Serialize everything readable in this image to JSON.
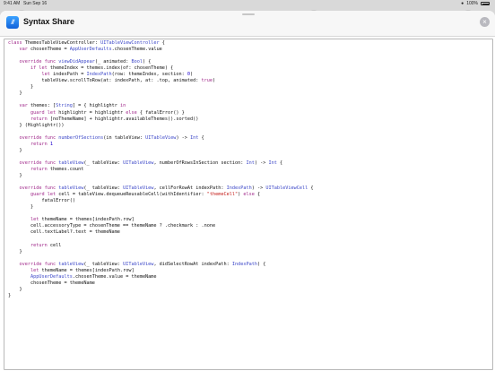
{
  "status_bar": {
    "time": "9:41 AM",
    "date": "Sun Sep 16",
    "battery": "100%"
  },
  "header": {
    "title": "Syntax Share",
    "app_icon_text": "//",
    "close_icon": "close-icon"
  },
  "colors": {
    "keyword": "#a0288a",
    "type": "#3c47c8",
    "string": "#c41a16",
    "number": "#1c00cf",
    "plain": "#111111",
    "accent": "#1a7cf0"
  },
  "code_lines": [
    [
      [
        "kw",
        "class"
      ],
      [
        "p",
        " ThemesTableViewController: "
      ],
      [
        "ty",
        "UITableViewController"
      ],
      [
        "p",
        " {"
      ]
    ],
    [
      [
        "p",
        "    "
      ],
      [
        "kw",
        "var"
      ],
      [
        "p",
        " chosenTheme = "
      ],
      [
        "ty",
        "AppUserDefaults"
      ],
      [
        "p",
        ".chosenTheme.value"
      ]
    ],
    [
      [
        "p",
        ""
      ]
    ],
    [
      [
        "p",
        "    "
      ],
      [
        "kw",
        "override func"
      ],
      [
        "p",
        " "
      ],
      [
        "ty",
        "viewDidAppear"
      ],
      [
        "p",
        "(_ animated: "
      ],
      [
        "ty",
        "Bool"
      ],
      [
        "p",
        ") {"
      ]
    ],
    [
      [
        "p",
        "        "
      ],
      [
        "kw",
        "if let"
      ],
      [
        "p",
        " themeIndex = themes.index(of: chosenTheme) {"
      ]
    ],
    [
      [
        "p",
        "            "
      ],
      [
        "kw",
        "let"
      ],
      [
        "p",
        " indexPath = "
      ],
      [
        "ty",
        "IndexPath"
      ],
      [
        "p",
        "(row: themeIndex, section: "
      ],
      [
        "num",
        "0"
      ],
      [
        "p",
        ")"
      ]
    ],
    [
      [
        "p",
        "            tableView.scrollToRow(at: indexPath, at: .top, animated: "
      ],
      [
        "kw",
        "true"
      ],
      [
        "p",
        ")"
      ]
    ],
    [
      [
        "p",
        "        }"
      ]
    ],
    [
      [
        "p",
        "    }"
      ]
    ],
    [
      [
        "p",
        ""
      ]
    ],
    [
      [
        "p",
        "    "
      ],
      [
        "kw",
        "var"
      ],
      [
        "p",
        " themes: ["
      ],
      [
        "ty",
        "String"
      ],
      [
        "p",
        "] = { highlightr "
      ],
      [
        "kw",
        "in"
      ]
    ],
    [
      [
        "p",
        "        "
      ],
      [
        "kw",
        "guard let"
      ],
      [
        "p",
        " highlightr = highlightr "
      ],
      [
        "kw",
        "else"
      ],
      [
        "p",
        " { fatalError() }"
      ]
    ],
    [
      [
        "p",
        "        "
      ],
      [
        "kw",
        "return"
      ],
      [
        "p",
        " [noThemeName] + highlightr.availableThemes().sorted()"
      ]
    ],
    [
      [
        "p",
        "    } (Highlightr())"
      ]
    ],
    [
      [
        "p",
        ""
      ]
    ],
    [
      [
        "p",
        "    "
      ],
      [
        "kw",
        "override func"
      ],
      [
        "p",
        " "
      ],
      [
        "ty",
        "numberOfSections"
      ],
      [
        "p",
        "(in tableView: "
      ],
      [
        "ty",
        "UITableView"
      ],
      [
        "p",
        ") -> "
      ],
      [
        "ty",
        "Int"
      ],
      [
        "p",
        " {"
      ]
    ],
    [
      [
        "p",
        "        "
      ],
      [
        "kw",
        "return"
      ],
      [
        "p",
        " "
      ],
      [
        "num",
        "1"
      ]
    ],
    [
      [
        "p",
        "    }"
      ]
    ],
    [
      [
        "p",
        ""
      ]
    ],
    [
      [
        "p",
        "    "
      ],
      [
        "kw",
        "override func"
      ],
      [
        "p",
        " "
      ],
      [
        "ty",
        "tableView"
      ],
      [
        "p",
        "(_ tableView: "
      ],
      [
        "ty",
        "UITableView"
      ],
      [
        "p",
        ", numberOfRowsInSection section: "
      ],
      [
        "ty",
        "Int"
      ],
      [
        "p",
        ") -> "
      ],
      [
        "ty",
        "Int"
      ],
      [
        "p",
        " {"
      ]
    ],
    [
      [
        "p",
        "        "
      ],
      [
        "kw",
        "return"
      ],
      [
        "p",
        " themes.count"
      ]
    ],
    [
      [
        "p",
        "    }"
      ]
    ],
    [
      [
        "p",
        ""
      ]
    ],
    [
      [
        "p",
        "    "
      ],
      [
        "kw",
        "override func"
      ],
      [
        "p",
        " "
      ],
      [
        "ty",
        "tableView"
      ],
      [
        "p",
        "(_ tableView: "
      ],
      [
        "ty",
        "UITableView"
      ],
      [
        "p",
        ", cellForRowAt indexPath: "
      ],
      [
        "ty",
        "IndexPath"
      ],
      [
        "p",
        ") -> "
      ],
      [
        "ty",
        "UITableViewCell"
      ],
      [
        "p",
        " {"
      ]
    ],
    [
      [
        "p",
        "        "
      ],
      [
        "kw",
        "guard let"
      ],
      [
        "p",
        " cell = tableView.dequeueReusableCell(withIdentifier: "
      ],
      [
        "str",
        "\"themeCell\""
      ],
      [
        "p",
        ") "
      ],
      [
        "kw",
        "else"
      ],
      [
        "p",
        " {"
      ]
    ],
    [
      [
        "p",
        "            fatalError()"
      ]
    ],
    [
      [
        "p",
        "        }"
      ]
    ],
    [
      [
        "p",
        ""
      ]
    ],
    [
      [
        "p",
        "        "
      ],
      [
        "kw",
        "let"
      ],
      [
        "p",
        " themeName = themes[indexPath.row]"
      ]
    ],
    [
      [
        "p",
        "        cell.accessoryType = chosenTheme == themeName ? .checkmark : .none"
      ]
    ],
    [
      [
        "p",
        "        cell.textLabel?.text = themeName"
      ]
    ],
    [
      [
        "p",
        ""
      ]
    ],
    [
      [
        "p",
        "        "
      ],
      [
        "kw",
        "return"
      ],
      [
        "p",
        " cell"
      ]
    ],
    [
      [
        "p",
        "    }"
      ]
    ],
    [
      [
        "p",
        ""
      ]
    ],
    [
      [
        "p",
        "    "
      ],
      [
        "kw",
        "override func"
      ],
      [
        "p",
        " "
      ],
      [
        "ty",
        "tableView"
      ],
      [
        "p",
        "(_ tableView: "
      ],
      [
        "ty",
        "UITableView"
      ],
      [
        "p",
        ", didSelectRowAt indexPath: "
      ],
      [
        "ty",
        "IndexPath"
      ],
      [
        "p",
        ") {"
      ]
    ],
    [
      [
        "p",
        "        "
      ],
      [
        "kw",
        "let"
      ],
      [
        "p",
        " themeName = themes[indexPath.row]"
      ]
    ],
    [
      [
        "p",
        "        "
      ],
      [
        "ty",
        "AppUserDefaults"
      ],
      [
        "p",
        ".chosenTheme.value = themeName"
      ]
    ],
    [
      [
        "p",
        "        chosenTheme = themeName"
      ]
    ],
    [
      [
        "p",
        "    }"
      ]
    ],
    [
      [
        "p",
        "}"
      ]
    ]
  ]
}
